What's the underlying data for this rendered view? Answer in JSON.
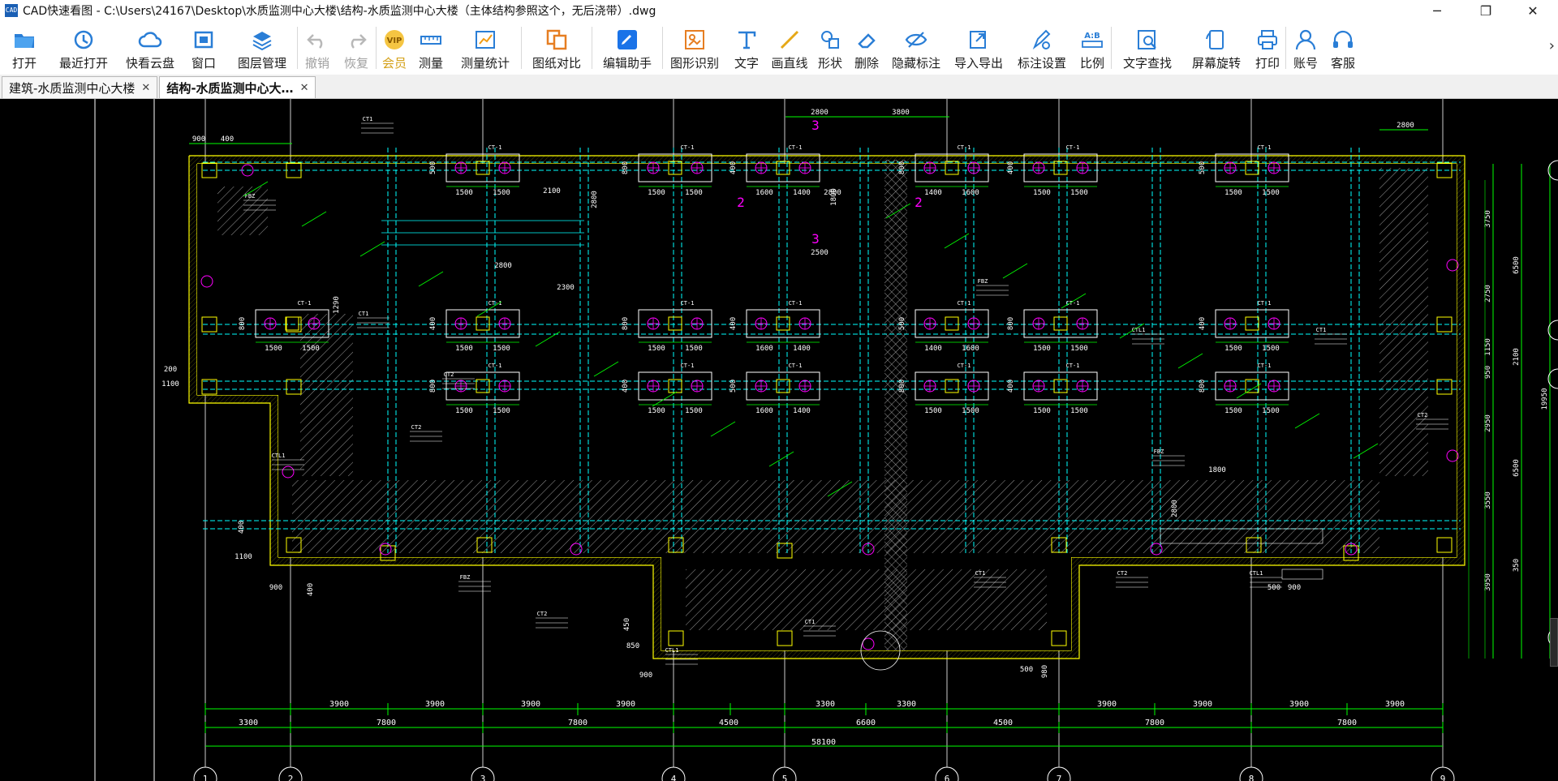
{
  "window": {
    "icon_text": "CAD",
    "title": "CAD快速看图 - C:\\Users\\24167\\Desktop\\水质监测中心大楼\\结构-水质监测中心大楼（主体结构参照这个，无后浇带）.dwg",
    "minimize": "─",
    "maximize": "❐",
    "close": "✕"
  },
  "toolbar": {
    "items": [
      {
        "label": "打开",
        "icon": "folder-open-icon"
      },
      {
        "label": "最近打开",
        "icon": "history-icon"
      },
      {
        "label": "快看云盘",
        "icon": "cloud-icon"
      },
      {
        "label": "窗口",
        "icon": "window-icon"
      },
      {
        "label": "图层管理",
        "icon": "layers-icon"
      },
      {
        "label": "撤销",
        "icon": "undo-icon"
      },
      {
        "label": "恢复",
        "icon": "redo-icon"
      },
      {
        "label": "会员",
        "icon": "vip-icon"
      },
      {
        "label": "测量",
        "icon": "ruler-icon"
      },
      {
        "label": "测量统计",
        "icon": "measure-stats-icon"
      },
      {
        "label": "图纸对比",
        "icon": "compare-icon"
      },
      {
        "label": "编辑助手",
        "icon": "edit-assistant-icon"
      },
      {
        "label": "图形识别",
        "icon": "shape-recognize-icon"
      },
      {
        "label": "文字",
        "icon": "text-icon"
      },
      {
        "label": "画直线",
        "icon": "line-icon"
      },
      {
        "label": "形状",
        "icon": "shapes-icon"
      },
      {
        "label": "删除",
        "icon": "eraser-icon"
      },
      {
        "label": "隐藏标注",
        "icon": "hide-eye-icon"
      },
      {
        "label": "导入导出",
        "icon": "import-export-icon"
      },
      {
        "label": "标注设置",
        "icon": "annotation-settings-icon"
      },
      {
        "label": "比例",
        "icon": "scale-icon"
      },
      {
        "label": "文字查找",
        "icon": "text-search-icon"
      },
      {
        "label": "屏幕旋转",
        "icon": "screen-rotate-icon"
      },
      {
        "label": "打印",
        "icon": "printer-icon"
      },
      {
        "label": "账号",
        "icon": "account-icon"
      },
      {
        "label": "客服",
        "icon": "headset-icon"
      }
    ],
    "more": "›",
    "vip_text": "VIP",
    "scale_text": "A:B"
  },
  "tabs": [
    {
      "label": "建筑-水质监测中心大楼",
      "close": "✕"
    },
    {
      "label": "结构-水质监测中心大…",
      "close": "✕"
    }
  ],
  "drawing": {
    "bottom_dims_1": [
      "3900",
      "3900",
      "3900",
      "3900",
      "3300",
      "3300",
      "3900",
      "3900",
      "3900",
      "3900"
    ],
    "bottom_dims_2": [
      "3300",
      "7800",
      "7800",
      "4500",
      "6600",
      "4500",
      "7800",
      "7800"
    ],
    "total_width": "58100",
    "axis_labels": [
      "1",
      "2",
      "3",
      "4",
      "5",
      "6",
      "7",
      "8",
      "9"
    ],
    "top_dims": [
      "900",
      "400",
      "2800",
      "3800",
      "2800"
    ],
    "right_dims": [
      "3750",
      "6500",
      "2750",
      "1150",
      "950",
      "2100",
      "2950",
      "6500",
      "3550",
      "19950",
      "3950",
      "350"
    ],
    "pile_dims": [
      "1500",
      "1500",
      "1600",
      "1400",
      "1400",
      "1600"
    ],
    "pile_height_dims": [
      "500",
      "800",
      "400",
      "800",
      "400"
    ],
    "misc_dims": [
      "2100",
      "2800",
      "2300",
      "2800",
      "1800",
      "2500",
      "2800",
      "1290",
      "1100",
      "200",
      "400",
      "1100",
      "900",
      "400",
      "900",
      "500",
      "980",
      "500",
      "900",
      "450",
      "850",
      "1800",
      "2800"
    ],
    "section_marks": [
      "3",
      "2",
      "3",
      "2"
    ],
    "cap_tag": "CT-1",
    "notes": [
      "CT1",
      "CT2",
      "FBZ",
      "CTL1"
    ]
  },
  "colors": {
    "canvas": "#000000",
    "grid_axis": "#ffffff",
    "beam": "#00ffff",
    "dim": "#00ff00",
    "column": "#ffff00",
    "pile": "#ff00ff",
    "wall": "#ffff00",
    "hatch": "#9a9a9a"
  }
}
